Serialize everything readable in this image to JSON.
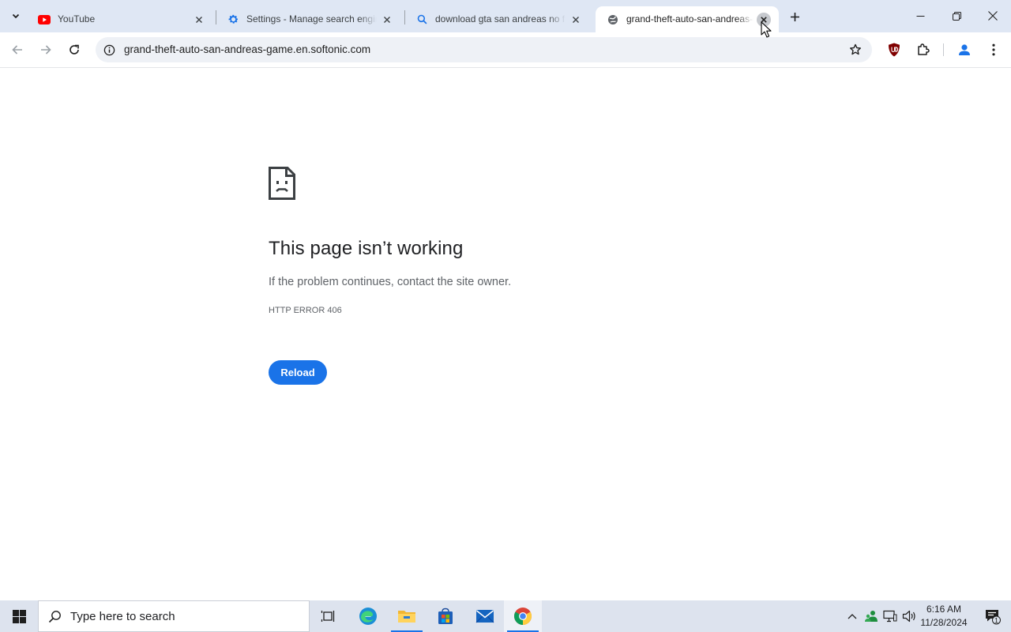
{
  "tabs": [
    {
      "title": "YouTube",
      "icon": "youtube-icon"
    },
    {
      "title": "Settings - Manage search engines",
      "icon": "settings-gear-icon"
    },
    {
      "title": "download gta san andreas no fi",
      "icon": "search-icon"
    },
    {
      "title": "grand-theft-auto-san-andreas-game",
      "icon": "globe-icon",
      "active": true
    }
  ],
  "address_bar": {
    "url": "grand-theft-auto-san-andreas-game.en.softonic.com"
  },
  "error_page": {
    "title": "This page isn’t working",
    "description": "If the problem continues, contact the site owner.",
    "error_code": "HTTP ERROR 406",
    "reload_label": "Reload"
  },
  "taskbar": {
    "search_placeholder": "Type here to search",
    "time": "6:16 AM",
    "date": "11/28/2024",
    "notification_count": "1"
  },
  "colors": {
    "accent": "#1a73e8",
    "tabstrip": "#dfe7f4",
    "youtube_red": "#ff0000"
  }
}
